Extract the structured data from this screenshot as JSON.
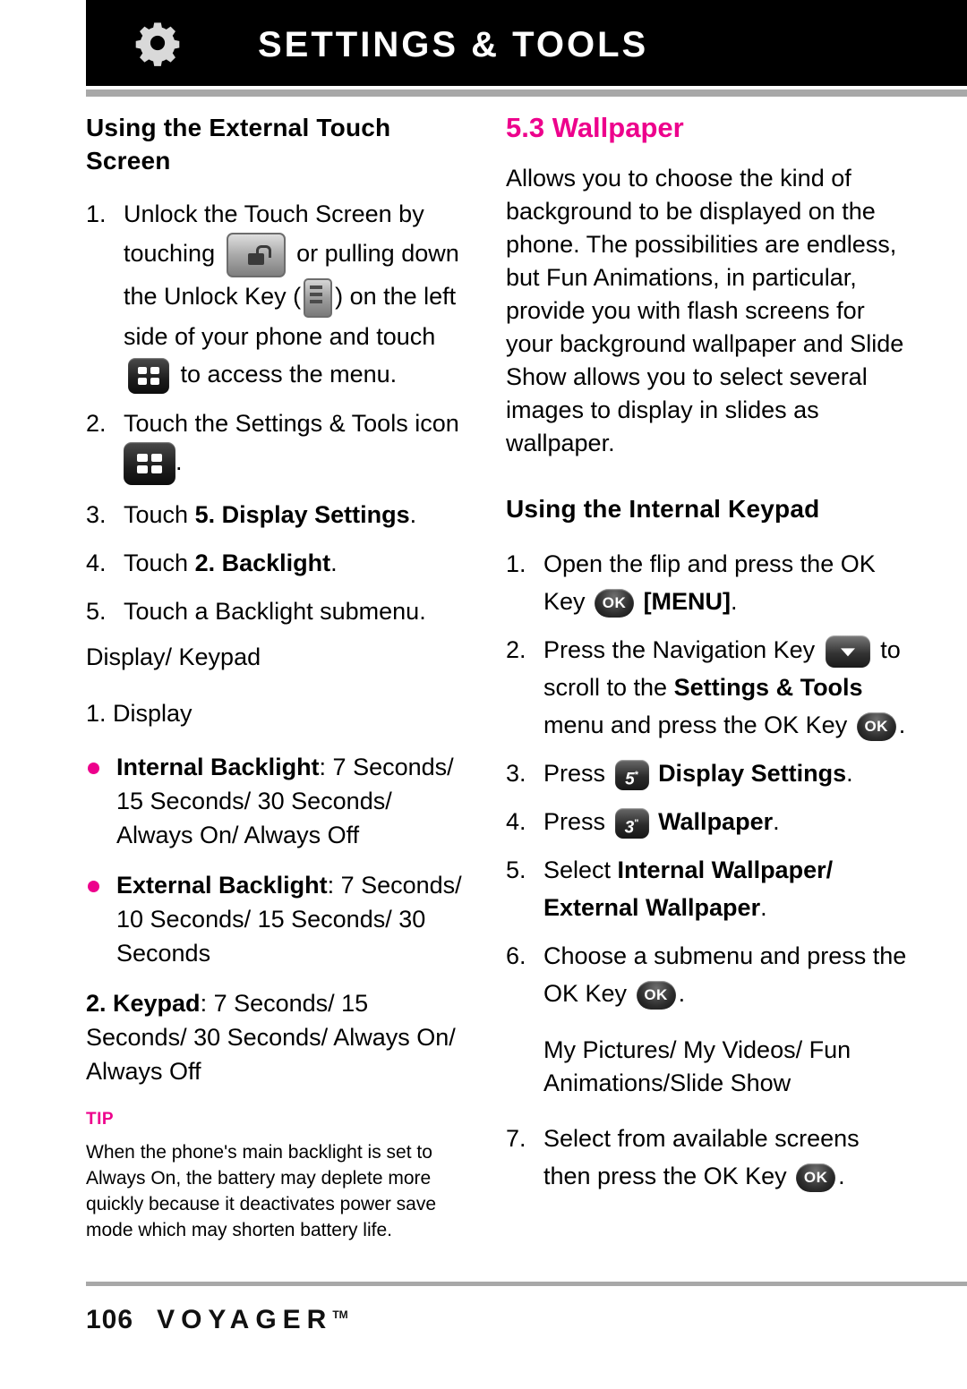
{
  "header": {
    "title": "SETTINGS & TOOLS",
    "icon": "gear-icon"
  },
  "left_column": {
    "section_title": "Using the External Touch Screen",
    "steps": [
      {
        "num": "1.",
        "parts": [
          "Unlock the Touch Screen by touching ",
          "[unlock-icon]",
          " or pulling down the Unlock Key (",
          "[slider-icon]",
          ") on the left side of your phone and touch ",
          "[menu-grid-icon]",
          " to access the menu."
        ],
        "text_1": "Unlock the Touch Screen by touching",
        "text_2": "or pulling down",
        "text_3": "the Unlock Key (",
        "text_4": ") on the left",
        "text_5": "side of your phone and touch",
        "text_6": "to access the menu."
      },
      {
        "num": "2.",
        "text_1": "Touch the Settings & Tools icon",
        "text_2": "."
      },
      {
        "num": "3.",
        "text_1": "Touch ",
        "bold_1": "5. Display Settings",
        "text_2": "."
      },
      {
        "num": "4.",
        "text_1": "Touch ",
        "bold_1": "2. Backlight",
        "text_2": "."
      },
      {
        "num": "5.",
        "text_1": "Touch a Backlight submenu."
      }
    ],
    "display_keypad_heading": "Display/ Keypad",
    "display_heading": "1. Display",
    "bullets": [
      {
        "bold": "Internal Backlight",
        "rest": ": 7 Seconds/ 15 Seconds/ 30 Seconds/ Always On/ Always Off"
      },
      {
        "bold": "External Backlight",
        "rest": ": 7 Seconds/ 10 Seconds/ 15 Seconds/ 30 Seconds"
      }
    ],
    "keypad_item": {
      "bold": "2. Keypad",
      "rest": ": 7 Seconds/ 15 Seconds/ 30 Seconds/ Always On/ Always Off"
    },
    "tip": {
      "label": "TIP",
      "body": "When the phone's main backlight is set to Always On, the battery may deplete more quickly because it deactivates power save mode which may shorten battery life."
    }
  },
  "right_column": {
    "section_number_title": "5.3 Wallpaper",
    "intro": "Allows you to choose the kind of background to be displayed on the phone. The possibilities are endless, but Fun Animations, in particular, provide you with flash screens for your background wallpaper and Slide Show allows you to select several images to display in slides as wallpaper.",
    "keypad_heading": "Using the Internal Keypad",
    "steps": [
      {
        "num": "1.",
        "text_1": "Open the flip and press the OK Key",
        "ok_key": "OK",
        "bold_1": "[MENU]",
        "text_2": "."
      },
      {
        "num": "2.",
        "text_1": "Press the Navigation Key",
        "text_2": "to scroll to the ",
        "bold_1": "Settings & Tools",
        "text_3": " menu and press the OK Key",
        "text_4": "."
      },
      {
        "num": "3.",
        "text_1": "Press",
        "key": "5",
        "key_sup": "*",
        "bold_1": "Display Settings",
        "text_2": "."
      },
      {
        "num": "4.",
        "text_1": "Press",
        "key": "3",
        "key_sup": "\"",
        "bold_1": "Wallpaper",
        "text_2": "."
      },
      {
        "num": "5.",
        "text_1": "Select ",
        "bold_1": "Internal Wallpaper/ External Wallpaper",
        "text_2": "."
      },
      {
        "num": "6.",
        "text_1": "Choose a submenu and press the OK Key",
        "text_2": "."
      }
    ],
    "submenu_options": "My Pictures/ My Videos/ Fun Animations/Slide Show",
    "final_step": {
      "num": "7.",
      "text_1": "Select from available screens then press the OK Key",
      "text_2": "."
    }
  },
  "footer": {
    "page_number": "106",
    "brand": "VOYAGER",
    "brand_tm": "TM"
  },
  "colors": {
    "accent": "#ED008C",
    "header_bg": "#000000",
    "rule": "#A8A8A8"
  }
}
